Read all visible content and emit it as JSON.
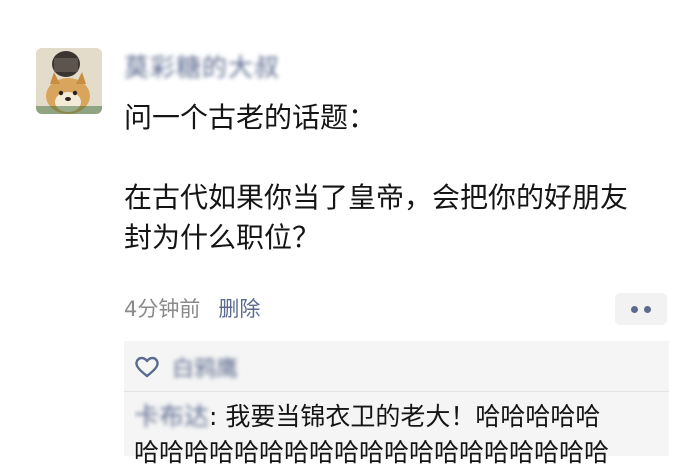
{
  "post": {
    "author": "莫彩糖的大叔",
    "lines": [
      "问一个古老的话题：",
      "",
      "在古代如果你当了皇帝，会把你的好朋友",
      "封为什么职位？"
    ],
    "time": "4分钟前",
    "delete_label": "删除"
  },
  "likes": {
    "names": "白鸦鹰"
  },
  "comments": [
    {
      "author": "卡布达",
      "separator": ":",
      "text": " 我要当锦衣卫的老大！哈哈哈哈哈",
      "line2": "哈哈哈哈哈哈哈哈哈哈哈哈哈哈哈哈哈哈哈"
    }
  ],
  "colors": {
    "link": "#5b6b8e",
    "meta": "#8a8a8a",
    "comment_bg": "#f5f5f5"
  }
}
